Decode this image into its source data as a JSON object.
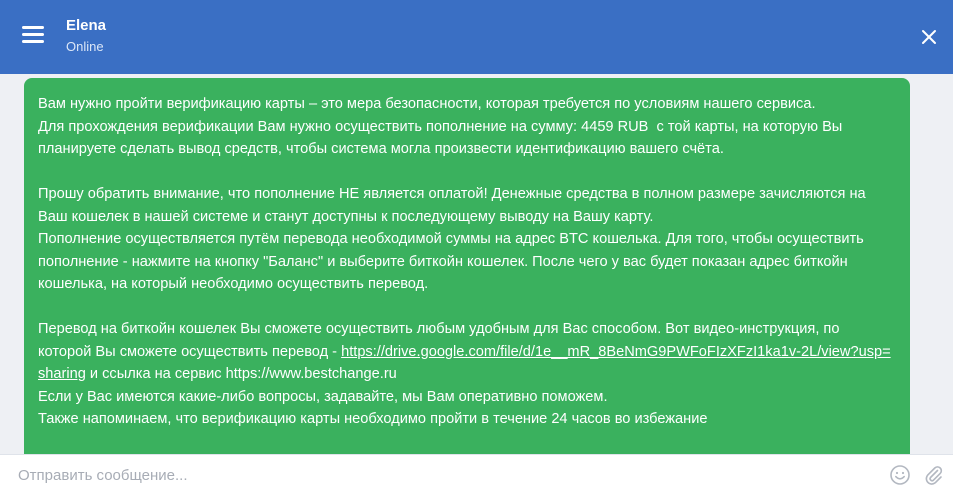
{
  "header": {
    "contact_name": "Elena",
    "status": "Online",
    "menu_icon": "hamburger-icon",
    "close_icon": "close-icon",
    "color": "#3a6fc4"
  },
  "message": {
    "color": "#3ab15e",
    "lines": [
      "Вам нужно пройти верификацию карты – это мера безопасности, которая требуется по условиям нашего сервиса.",
      "Для прохождения верификации Вам нужно осуществить пополнение на сумму: 4459 RUB  с той карты, на которую Вы планируете сделать вывод средств, чтобы система могла произвести идентификацию вашего счёта.",
      "",
      "Прошу обратить внимание, что пополнение НЕ является оплатой! Денежные средства в полном размере зачисляются на Ваш кошелек в нашей системе и станут доступны к последующему выводу на Вашу карту.",
      "Пополнение осуществляется путём перевода необходимой суммы на адрес BTC кошелька. Для того, чтобы осуществить пополнение - нажмите на кнопку \"Баланс\" и выберите биткойн кошелек. После чего у вас будет показан адрес биткойн кошелька, на который необходимо осуществить перевод.",
      ""
    ],
    "video_text_before": "Перевод на биткойн кошелек Вы сможете осуществить любым удобным для Вас способом. Вот видео-инструкция, по которой Вы сможете осуществить перевод - ",
    "video_link": "https://drive.google.com/file/d/1e__mR_8BeNmG9PWFoFIzXFzI1ka1v-2L/view?usp=sharing",
    "video_text_after": " и ссылка на сервис https://www.bestchange.ru",
    "questions_line": "Если у Вас имеются какие-либо вопросы, задавайте, мы Вам оперативно поможем.",
    "reminder_line": "Также напоминаем, что верификацию карты необходимо пройти в течение 24 часов во избежание"
  },
  "composer": {
    "placeholder": "Отправить сообщение...",
    "emoji_icon": "smiley-icon",
    "attach_icon": "paperclip-icon"
  }
}
